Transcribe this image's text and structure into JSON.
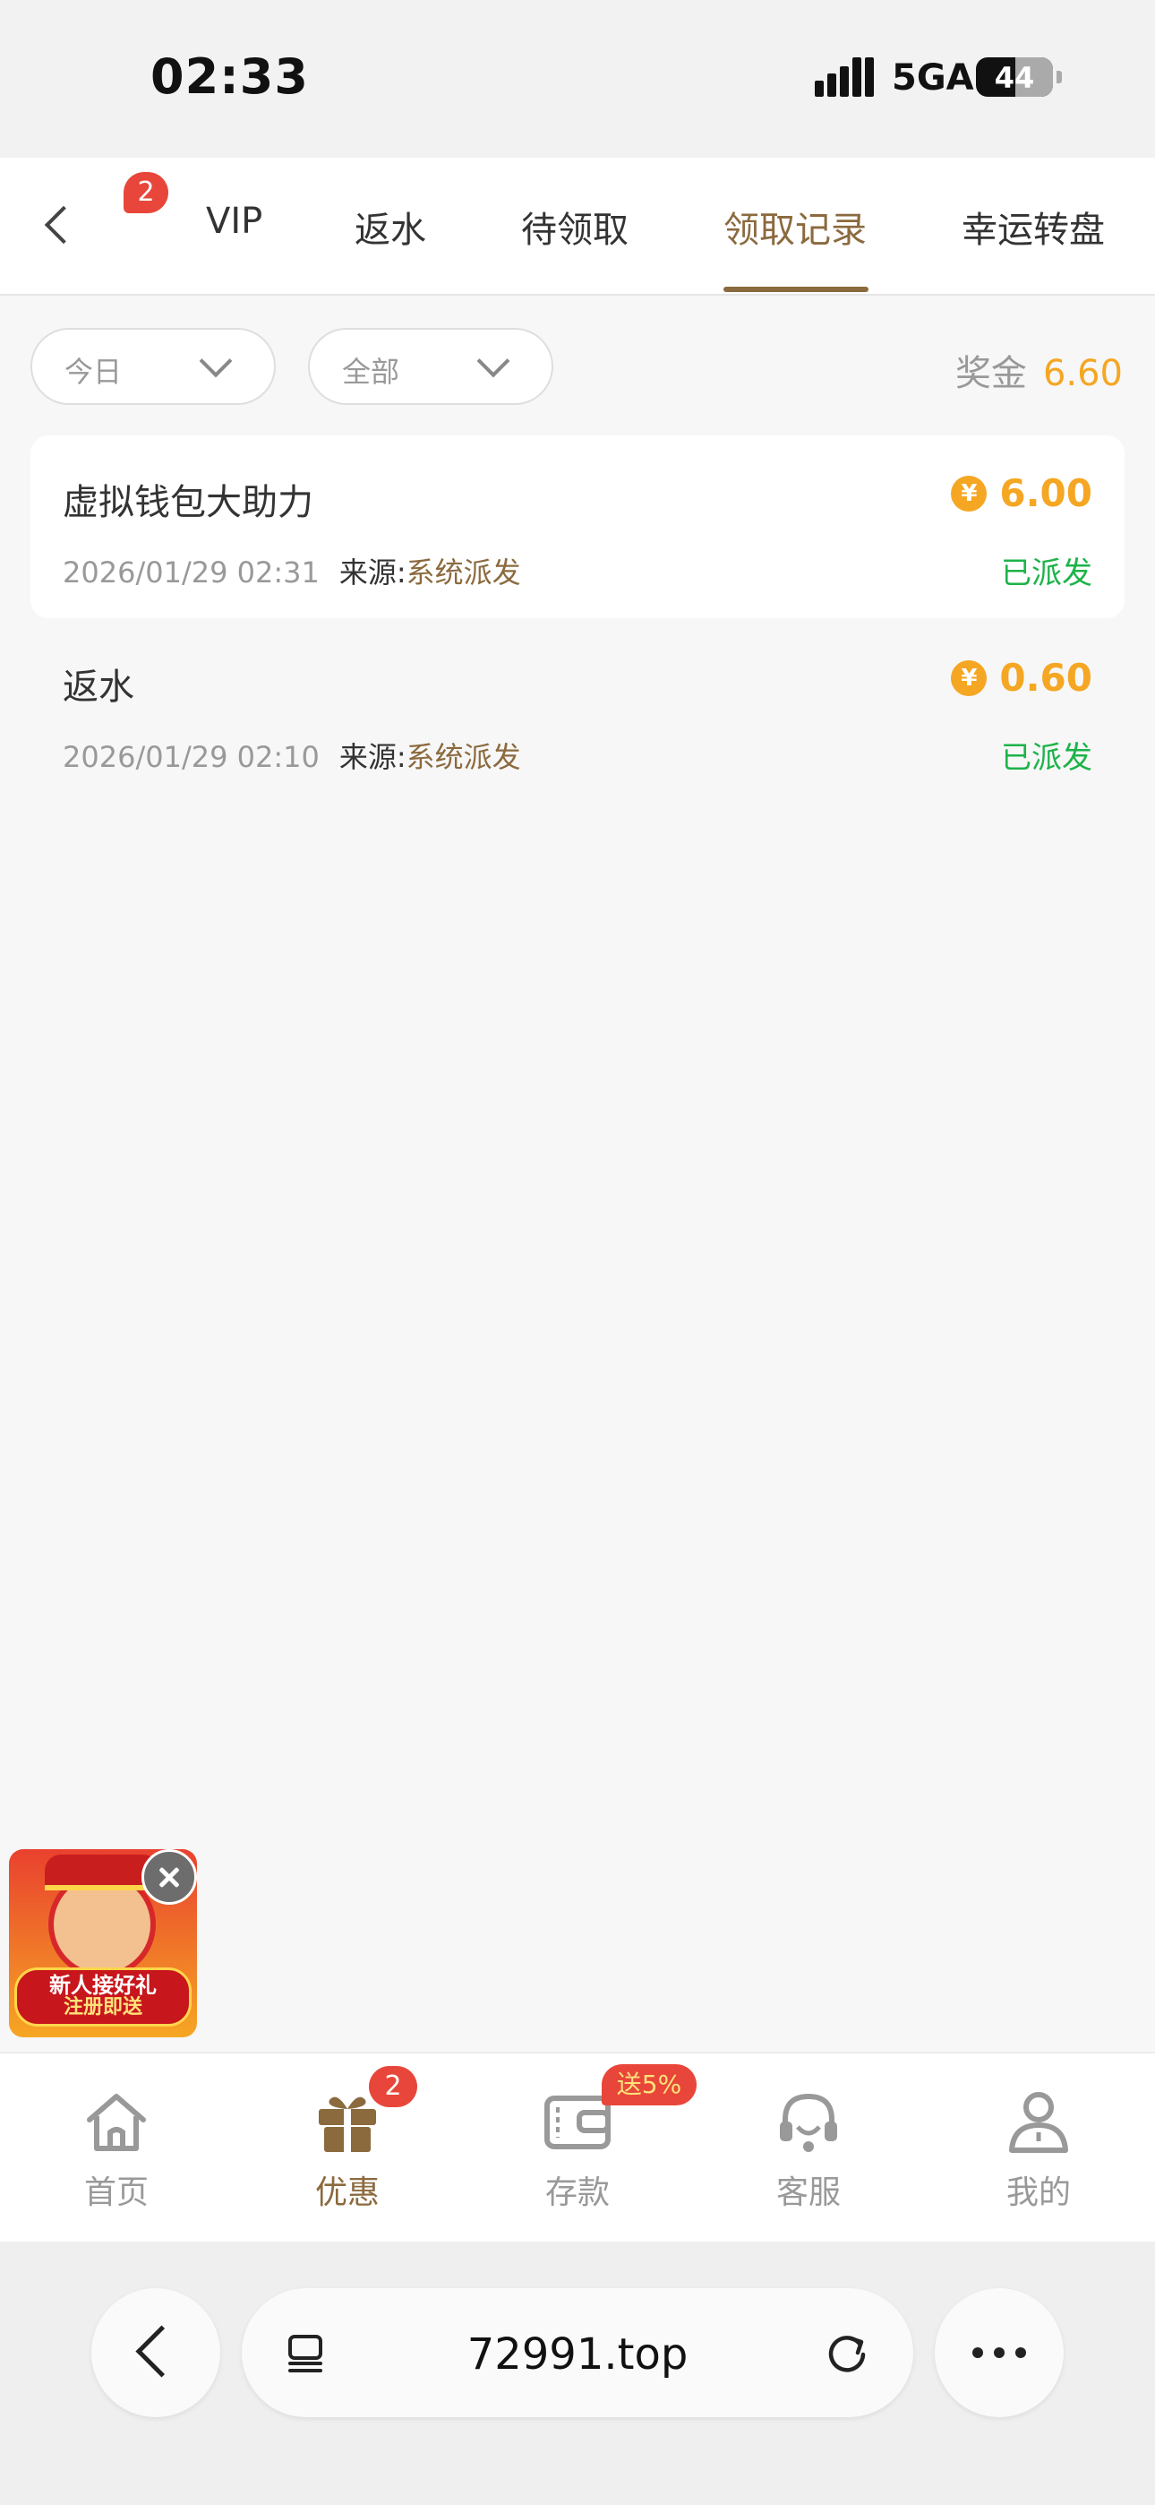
{
  "status_bar": {
    "time": "02:33",
    "network": "5GA",
    "battery": "44"
  },
  "top_nav": {
    "badge": "2",
    "tabs": [
      {
        "label": "VIP"
      },
      {
        "label": "返水"
      },
      {
        "label": "待领取"
      },
      {
        "label": "领取记录",
        "active": true
      },
      {
        "label": "幸运转盘"
      }
    ]
  },
  "filters": {
    "date": {
      "label": "今日"
    },
    "category": {
      "label": "全部"
    },
    "bonus_label": "奖金",
    "bonus_value": "6.60"
  },
  "records": [
    {
      "title": "虚拟钱包大助力",
      "coin_symbol": "¥",
      "amount": "6.00",
      "date": "2026/01/29 02:31",
      "source_label": "来源:",
      "source": "系统派发",
      "status": "已派发"
    },
    {
      "title": "返水",
      "coin_symbol": "¥",
      "amount": "0.60",
      "date": "2026/01/29 02:10",
      "source_label": "来源:",
      "source": "系统派发",
      "status": "已派发"
    }
  ],
  "promo": {
    "line1": "新人接好礼",
    "line2": "注册即送"
  },
  "tab_bar": {
    "items": [
      {
        "label": "首页",
        "icon": "home-icon"
      },
      {
        "label": "优惠",
        "icon": "gift-icon",
        "active": true
      },
      {
        "label": "存款",
        "icon": "wallet-icon"
      },
      {
        "label": "客服",
        "icon": "headset-icon"
      },
      {
        "label": "我的",
        "icon": "user-icon"
      }
    ],
    "promo_badge": "2",
    "deposit_tag": "送5%"
  },
  "browser": {
    "url": "72991.top"
  },
  "colors": {
    "accent": "#8b6a3e",
    "amount": "#f5a623",
    "status_ok": "#1db34a",
    "badge": "#e8463a"
  }
}
